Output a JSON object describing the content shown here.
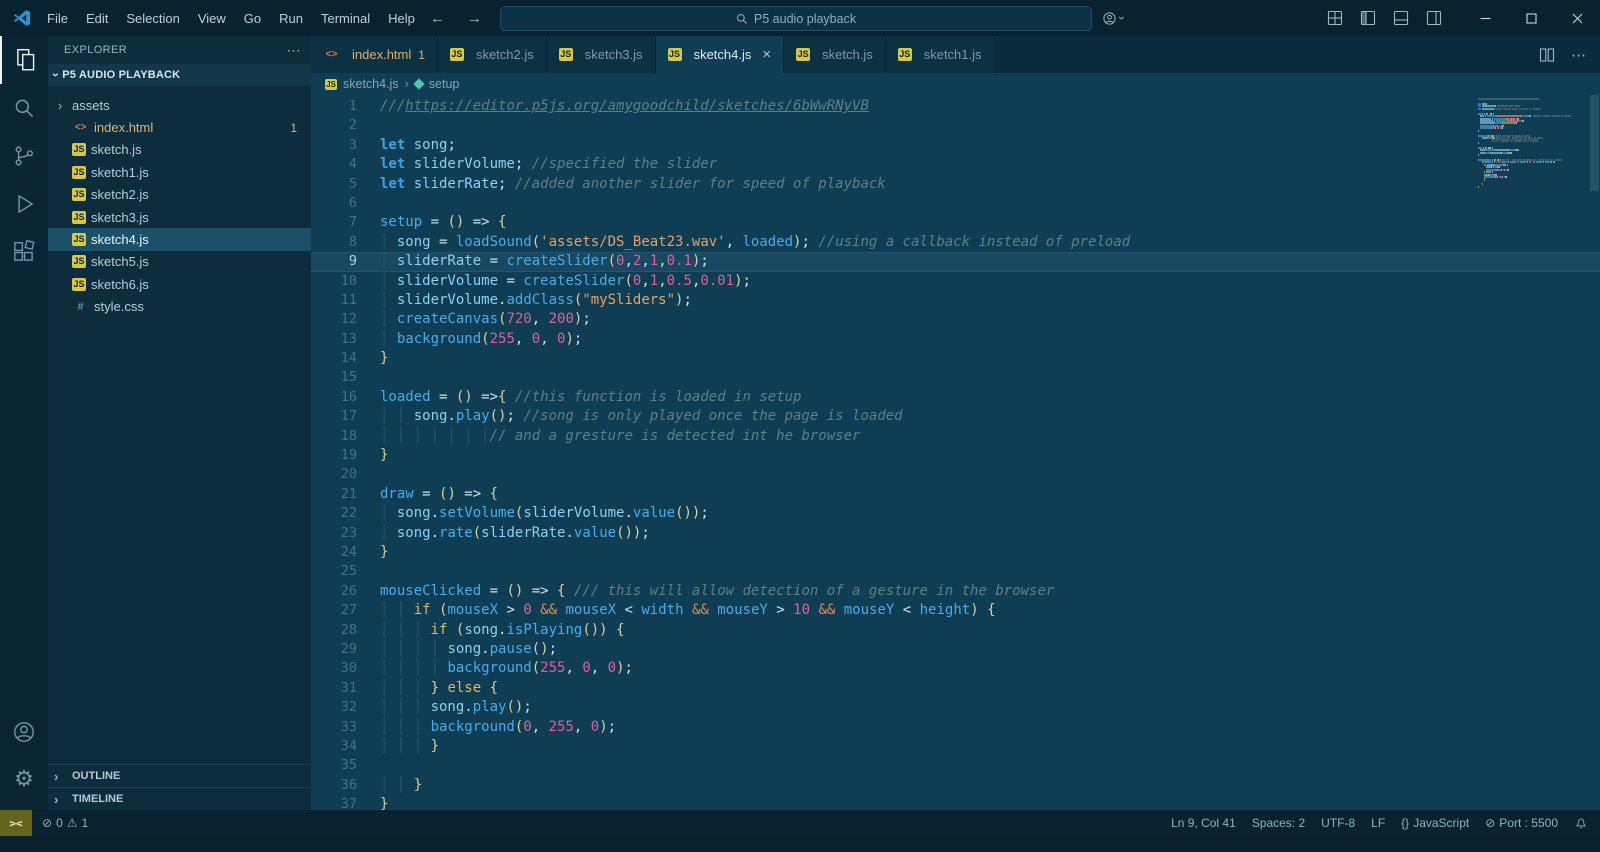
{
  "titlebar": {
    "menus": [
      "File",
      "Edit",
      "Selection",
      "View",
      "Go",
      "Run",
      "Terminal",
      "Help"
    ],
    "search": "P5 audio playback"
  },
  "icons": {
    "chevron": "›",
    "more": "⋯",
    "close": "×",
    "back": "←",
    "forward": "→",
    "error": "⊘",
    "warning": "⚠",
    "braces": "{}",
    "port_icon": "⊘",
    "gear": "⚙",
    "js": "JS",
    "html": "<>",
    "css": "#"
  },
  "sidebar": {
    "title": "EXPLORER",
    "project": "P5 AUDIO PLAYBACK",
    "items": [
      {
        "label": "assets",
        "type": "folder"
      },
      {
        "label": "index.html",
        "type": "html",
        "modified": true,
        "badge": "1"
      },
      {
        "label": "sketch.js",
        "type": "js"
      },
      {
        "label": "sketch1.js",
        "type": "js"
      },
      {
        "label": "sketch2.js",
        "type": "js"
      },
      {
        "label": "sketch3.js",
        "type": "js"
      },
      {
        "label": "sketch4.js",
        "type": "js",
        "selected": true
      },
      {
        "label": "sketch5.js",
        "type": "js"
      },
      {
        "label": "sketch6.js",
        "type": "js"
      },
      {
        "label": "style.css",
        "type": "css"
      }
    ],
    "sections": [
      "OUTLINE",
      "TIMELINE"
    ]
  },
  "tabs": [
    {
      "label": "index.html",
      "kind": "html",
      "badge": "1",
      "modified": true
    },
    {
      "label": "sketch2.js",
      "kind": "js"
    },
    {
      "label": "sketch3.js",
      "kind": "js"
    },
    {
      "label": "sketch4.js",
      "kind": "js",
      "active": true
    },
    {
      "label": "sketch.js",
      "kind": "js"
    },
    {
      "label": "sketch1.js",
      "kind": "js"
    }
  ],
  "breadcrumb": {
    "file": "sketch4.js",
    "symbol": "setup"
  },
  "editor": {
    "active_line": 9,
    "lines": [
      [
        [
          "c",
          "///"
        ],
        [
          "u",
          "https://editor.p5js.org/amygoodchild/sketches/6bWwRNyVB"
        ]
      ],
      [],
      [
        [
          "k",
          "let "
        ],
        [
          "v",
          "song"
        ],
        [
          "p",
          ";"
        ]
      ],
      [
        [
          "k",
          "let "
        ],
        [
          "v",
          "sliderVolume"
        ],
        [
          "p",
          "; "
        ],
        [
          "c",
          "//specified the slider"
        ]
      ],
      [
        [
          "k",
          "let "
        ],
        [
          "v",
          "sliderRate"
        ],
        [
          "p",
          "; "
        ],
        [
          "c",
          "//added another slider for speed of playback"
        ]
      ],
      [],
      [
        [
          "f",
          "setup"
        ],
        [
          "p",
          " = "
        ],
        [
          "b",
          "()"
        ],
        [
          "p",
          " => "
        ],
        [
          "b",
          "{"
        ]
      ],
      [
        [
          "g",
          "│ "
        ],
        [
          "v",
          "song"
        ],
        [
          "p",
          " = "
        ],
        [
          "f",
          "loadSound"
        ],
        [
          "b",
          "("
        ],
        [
          "s",
          "'assets/DS_Beat23.wav'"
        ],
        [
          "p",
          ", "
        ],
        [
          "f",
          "loaded"
        ],
        [
          "b",
          ")"
        ],
        [
          "p",
          "; "
        ],
        [
          "c",
          "//using a callback instead of preload"
        ]
      ],
      [
        [
          "g",
          "│ "
        ],
        [
          "v",
          "sliderRate"
        ],
        [
          "p",
          " = "
        ],
        [
          "f",
          "createSlider"
        ],
        [
          "b",
          "("
        ],
        [
          "n",
          "0"
        ],
        [
          "p",
          ","
        ],
        [
          "n",
          "2"
        ],
        [
          "p",
          ","
        ],
        [
          "n",
          "1"
        ],
        [
          "p",
          ","
        ],
        [
          "n",
          "0.1"
        ],
        [
          "b",
          ")"
        ],
        [
          "p",
          ";"
        ]
      ],
      [
        [
          "g",
          "│ "
        ],
        [
          "v",
          "sliderVolume"
        ],
        [
          "p",
          " = "
        ],
        [
          "f",
          "createSlider"
        ],
        [
          "b",
          "("
        ],
        [
          "n",
          "0"
        ],
        [
          "p",
          ","
        ],
        [
          "n",
          "1"
        ],
        [
          "p",
          ","
        ],
        [
          "n",
          "0.5"
        ],
        [
          "p",
          ","
        ],
        [
          "n",
          "0.01"
        ],
        [
          "b",
          ")"
        ],
        [
          "p",
          ";"
        ]
      ],
      [
        [
          "g",
          "│ "
        ],
        [
          "v",
          "sliderVolume"
        ],
        [
          "p",
          "."
        ],
        [
          "f",
          "addClass"
        ],
        [
          "b",
          "("
        ],
        [
          "s",
          "\"mySliders\""
        ],
        [
          "b",
          ")"
        ],
        [
          "p",
          ";"
        ]
      ],
      [
        [
          "g",
          "│ "
        ],
        [
          "f",
          "createCanvas"
        ],
        [
          "b",
          "("
        ],
        [
          "n",
          "720"
        ],
        [
          "p",
          ", "
        ],
        [
          "n",
          "200"
        ],
        [
          "b",
          ")"
        ],
        [
          "p",
          ";"
        ]
      ],
      [
        [
          "g",
          "│ "
        ],
        [
          "f",
          "background"
        ],
        [
          "b",
          "("
        ],
        [
          "n",
          "255"
        ],
        [
          "p",
          ", "
        ],
        [
          "n",
          "0"
        ],
        [
          "p",
          ", "
        ],
        [
          "n",
          "0"
        ],
        [
          "b",
          ")"
        ],
        [
          "p",
          ";"
        ]
      ],
      [
        [
          "b",
          "}"
        ]
      ],
      [],
      [
        [
          "f",
          "loaded"
        ],
        [
          "p",
          " = "
        ],
        [
          "b",
          "()"
        ],
        [
          "p",
          " =>"
        ],
        [
          "b",
          "{"
        ],
        [
          "p",
          " "
        ],
        [
          "c",
          "//this function is loaded in setup"
        ]
      ],
      [
        [
          "g",
          "│ │ "
        ],
        [
          "v",
          "song"
        ],
        [
          "p",
          "."
        ],
        [
          "f",
          "play"
        ],
        [
          "b",
          "()"
        ],
        [
          "p",
          "; "
        ],
        [
          "c",
          "//song is only played once the page is loaded"
        ]
      ],
      [
        [
          "g",
          "│ │ │ │ │ │ │"
        ],
        [
          "c",
          "// and a gresture is detected int he browser"
        ]
      ],
      [
        [
          "b",
          "}"
        ]
      ],
      [],
      [
        [
          "f",
          "draw"
        ],
        [
          "p",
          " = "
        ],
        [
          "b",
          "()"
        ],
        [
          "p",
          " => "
        ],
        [
          "b",
          "{"
        ]
      ],
      [
        [
          "g",
          "│ "
        ],
        [
          "v",
          "song"
        ],
        [
          "p",
          "."
        ],
        [
          "f",
          "setVolume"
        ],
        [
          "b",
          "("
        ],
        [
          "v",
          "sliderVolume"
        ],
        [
          "p",
          "."
        ],
        [
          "f",
          "value"
        ],
        [
          "b",
          "())"
        ],
        [
          "p",
          ";"
        ]
      ],
      [
        [
          "g",
          "│ "
        ],
        [
          "v",
          "song"
        ],
        [
          "p",
          "."
        ],
        [
          "f",
          "rate"
        ],
        [
          "b",
          "("
        ],
        [
          "v",
          "sliderRate"
        ],
        [
          "p",
          "."
        ],
        [
          "f",
          "value"
        ],
        [
          "b",
          "())"
        ],
        [
          "p",
          ";"
        ]
      ],
      [
        [
          "b",
          "}"
        ]
      ],
      [],
      [
        [
          "f",
          "mouseClicked"
        ],
        [
          "p",
          " = "
        ],
        [
          "b",
          "()"
        ],
        [
          "p",
          " => "
        ],
        [
          "b",
          "{"
        ],
        [
          "p",
          " "
        ],
        [
          "c",
          "/// this will allow detection of a gesture in the browser"
        ]
      ],
      [
        [
          "g",
          "│ │ "
        ],
        [
          "ct",
          "if"
        ],
        [
          "p",
          " "
        ],
        [
          "b",
          "("
        ],
        [
          "f",
          "mouseX"
        ],
        [
          "p",
          " > "
        ],
        [
          "n",
          "0"
        ],
        [
          "p",
          " "
        ],
        [
          "a",
          "&&"
        ],
        [
          "p",
          " "
        ],
        [
          "f",
          "mouseX"
        ],
        [
          "p",
          " < "
        ],
        [
          "f",
          "width"
        ],
        [
          "p",
          " "
        ],
        [
          "a",
          "&&"
        ],
        [
          "p",
          " "
        ],
        [
          "f",
          "mouseY"
        ],
        [
          "p",
          " > "
        ],
        [
          "n",
          "10"
        ],
        [
          "p",
          " "
        ],
        [
          "a",
          "&&"
        ],
        [
          "p",
          " "
        ],
        [
          "f",
          "mouseY"
        ],
        [
          "p",
          " < "
        ],
        [
          "f",
          "height"
        ],
        [
          "b",
          ")"
        ],
        [
          "p",
          " "
        ],
        [
          "b",
          "{"
        ]
      ],
      [
        [
          "g",
          "│ │ │ "
        ],
        [
          "ct",
          "if"
        ],
        [
          "p",
          " "
        ],
        [
          "b",
          "("
        ],
        [
          "v",
          "song"
        ],
        [
          "p",
          "."
        ],
        [
          "f",
          "isPlaying"
        ],
        [
          "b",
          "())"
        ],
        [
          "p",
          " "
        ],
        [
          "b",
          "{"
        ]
      ],
      [
        [
          "g",
          "│ │ │ │ "
        ],
        [
          "v",
          "song"
        ],
        [
          "p",
          "."
        ],
        [
          "f",
          "pause"
        ],
        [
          "b",
          "()"
        ],
        [
          "p",
          ";"
        ]
      ],
      [
        [
          "g",
          "│ │ │ │ "
        ],
        [
          "f",
          "background"
        ],
        [
          "b",
          "("
        ],
        [
          "n",
          "255"
        ],
        [
          "p",
          ", "
        ],
        [
          "n",
          "0"
        ],
        [
          "p",
          ", "
        ],
        [
          "n",
          "0"
        ],
        [
          "b",
          ")"
        ],
        [
          "p",
          ";"
        ]
      ],
      [
        [
          "g",
          "│ │ │ "
        ],
        [
          "b",
          "}"
        ],
        [
          "p",
          " "
        ],
        [
          "ct",
          "else"
        ],
        [
          "p",
          " "
        ],
        [
          "b",
          "{"
        ]
      ],
      [
        [
          "g",
          "│ │ │ "
        ],
        [
          "v",
          "song"
        ],
        [
          "p",
          "."
        ],
        [
          "f",
          "play"
        ],
        [
          "b",
          "()"
        ],
        [
          "p",
          ";"
        ]
      ],
      [
        [
          "g",
          "│ │ │ "
        ],
        [
          "f",
          "background"
        ],
        [
          "b",
          "("
        ],
        [
          "n",
          "0"
        ],
        [
          "p",
          ", "
        ],
        [
          "n",
          "255"
        ],
        [
          "p",
          ", "
        ],
        [
          "n",
          "0"
        ],
        [
          "b",
          ")"
        ],
        [
          "p",
          ";"
        ]
      ],
      [
        [
          "g",
          "│ │ │ "
        ],
        [
          "b",
          "}"
        ]
      ],
      [],
      [
        [
          "g",
          "│ │ "
        ],
        [
          "b",
          "}"
        ]
      ],
      [
        [
          "b",
          "}"
        ]
      ]
    ]
  },
  "status": {
    "remote": "><",
    "errors": "0",
    "warnings": "1",
    "cursor": "Ln 9, Col 41",
    "indent": "Spaces: 2",
    "encoding": "UTF-8",
    "eol": "LF",
    "language": "JavaScript",
    "port": "Port : 5500"
  },
  "colors": {
    "accent": "#2797d4",
    "modified_orange": "#dcb67a",
    "js_icon_yellow": "#d9c749",
    "html_icon_orange": "#e07c3c",
    "css_icon_blue": "#519aba",
    "number_pink": "#e0609e",
    "string_orange": "#e8a262",
    "editor_bg": "#0f3d53"
  }
}
